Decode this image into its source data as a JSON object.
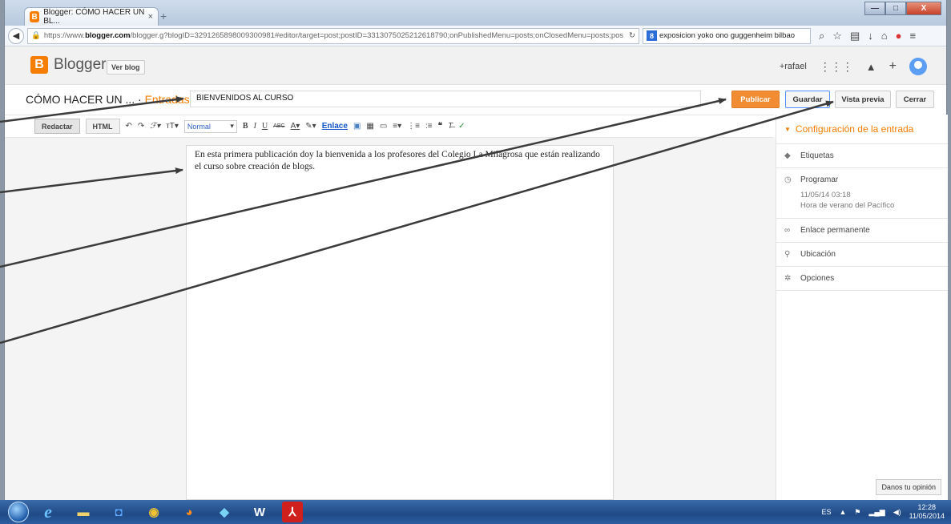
{
  "browser": {
    "tab_title": "Blogger: CÓMO HACER UN BL...",
    "tab_close": "×",
    "new_tab": "+",
    "url_prefix": "https://www.",
    "url_domain": "blogger.com",
    "url_rest": "/blogger.g?blogID=3291265898009300981#editor/target=post;postID=3313075025212618790;onPublishedMenu=posts;onClosedMenu=posts;pos",
    "search_text": "exposicion yoko ono guggenheim bilbao",
    "window_minimize": "—",
    "window_maximize": "□",
    "window_close": "X"
  },
  "blogger_header": {
    "logo_letter": "B",
    "logo_text": "Blogger",
    "view_blog": "Ver blog",
    "user": "+rafael"
  },
  "post": {
    "breadcrumb_blog": "CÓMO HACER UN ...",
    "breadcrumb_sep": " · ",
    "breadcrumb_section": "Entradas",
    "title_value": "BIENVENIDOS AL CURSO",
    "publish": "Publicar",
    "save": "Guardar",
    "preview": "Vista previa",
    "close": "Cerrar"
  },
  "toolbar": {
    "compose": "Redactar",
    "html": "HTML",
    "font_size": "Normal",
    "link": "Enlace"
  },
  "editor": {
    "body": "En esta primera publicación doy la bienvenida a los profesores del Colegio La Milagrosa que están realizando el curso sobre creación de blogs."
  },
  "sidebar": {
    "heading": "Configuración de la entrada",
    "items": [
      {
        "label": "Etiquetas",
        "icon": "tag-icon",
        "glyph": "◆"
      },
      {
        "label": "Programar",
        "icon": "clock-icon",
        "glyph": "◷",
        "detail1": "11/05/14 03:18",
        "detail2": "Hora de verano del Pacífico"
      },
      {
        "label": "Enlace permanente",
        "icon": "link-icon",
        "glyph": "∞"
      },
      {
        "label": "Ubicación",
        "icon": "location-pin-icon",
        "glyph": "⚲"
      },
      {
        "label": "Opciones",
        "icon": "gear-icon",
        "glyph": "✲"
      }
    ],
    "feedback": "Danos tu opinión"
  },
  "taskbar": {
    "language": "ES",
    "time": "12:28",
    "date": "11/05/2014"
  },
  "colors": {
    "brand_orange": "#f57d00",
    "publish_button": "#f28c32",
    "arrow_annotations": "#3b3b3b"
  }
}
